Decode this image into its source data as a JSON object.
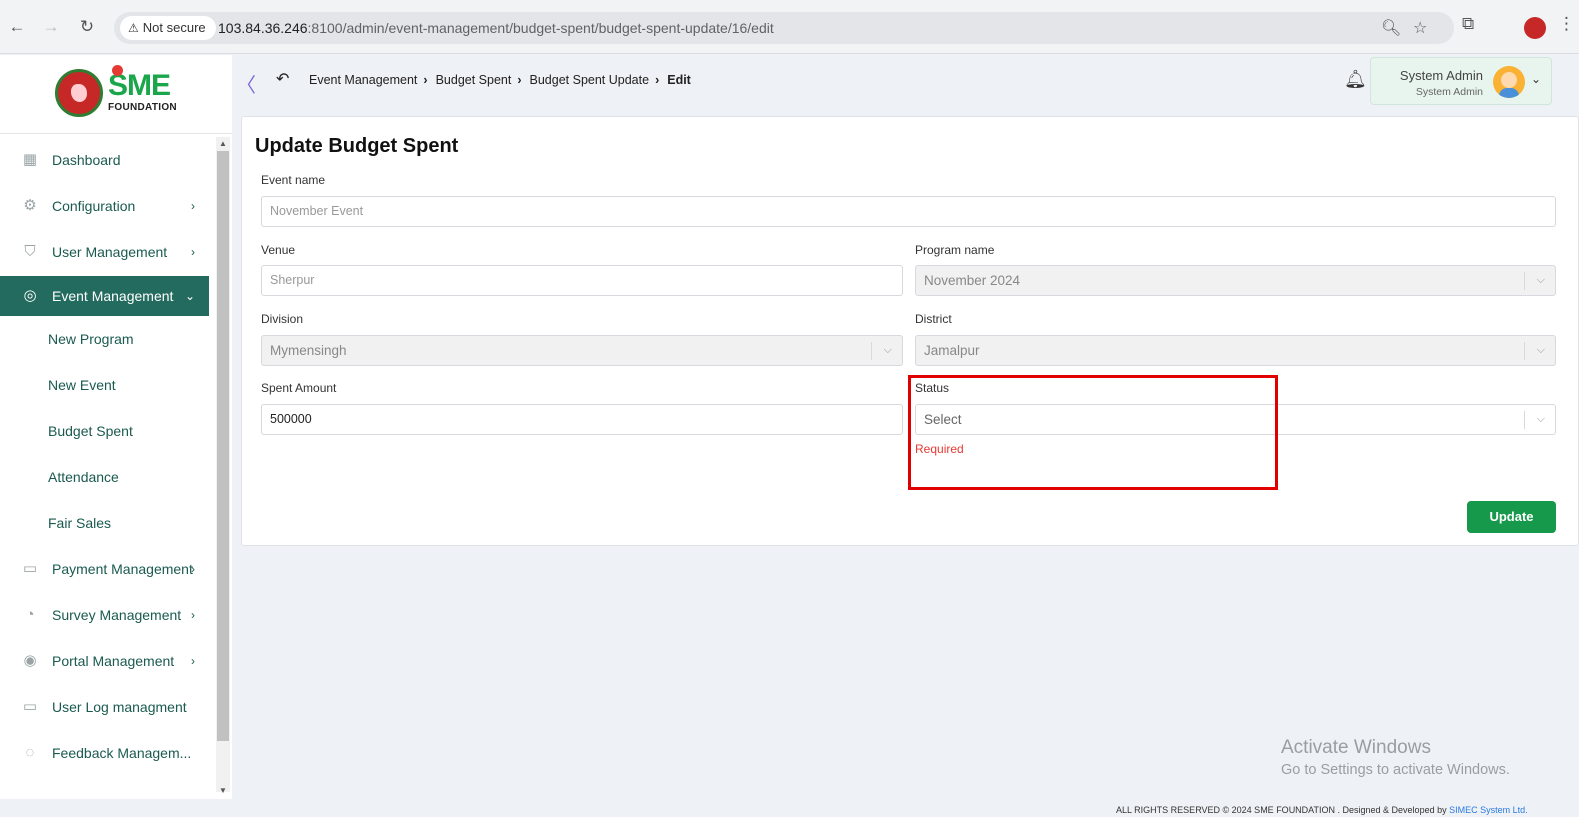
{
  "browser": {
    "security_label": "Not secure",
    "url_host": "103.84.36.246",
    "url_rest": ":8100/admin/event-management/budget-spent/budget-spent-update/16/edit"
  },
  "logo": {
    "sme": "SME",
    "foundation": "FOUNDATION"
  },
  "sidebar": {
    "items": [
      {
        "label": "Dashboard",
        "icon": "grid-icon",
        "arrow": ""
      },
      {
        "label": "Configuration",
        "icon": "config-icon",
        "arrow": "›"
      },
      {
        "label": "User Management",
        "icon": "shield-icon",
        "arrow": "›"
      },
      {
        "label": "Event Management",
        "icon": "event-icon",
        "arrow": "⌄"
      }
    ],
    "sub_items": [
      "New Program",
      "New Event",
      "Budget Spent",
      "Attendance",
      "Fair Sales"
    ],
    "items_after": [
      {
        "label": "Payment Management",
        "icon": "payment-icon",
        "arrow": "›"
      },
      {
        "label": "Survey Management",
        "icon": "pie-icon",
        "arrow": "›"
      },
      {
        "label": "Portal Management",
        "icon": "portal-icon",
        "arrow": "›"
      },
      {
        "label": "User Log managment",
        "icon": "log-icon",
        "arrow": ""
      },
      {
        "label": "Feedback Managem...",
        "icon": "feedback-icon",
        "arrow": ""
      }
    ]
  },
  "header": {
    "breadcrumb": [
      "Event Management",
      "Budget Spent",
      "Budget Spent Update",
      "Edit"
    ],
    "user_name": "System Admin",
    "user_role": "System Admin"
  },
  "form": {
    "title": "Update Budget Spent",
    "event_name_label": "Event name",
    "event_name_value": "November Event",
    "venue_label": "Venue",
    "venue_value": "Sherpur",
    "program_label": "Program name",
    "program_value": "November 2024",
    "division_label": "Division",
    "division_value": "Mymensingh",
    "district_label": "District",
    "district_value": "Jamalpur",
    "spent_label": "Spent Amount",
    "spent_value": "500000",
    "status_label": "Status",
    "status_placeholder": "Select",
    "status_error": "Required",
    "update_label": "Update"
  },
  "watermark": {
    "title": "Activate Windows",
    "subtitle": "Go to Settings to activate Windows."
  },
  "footer": {
    "text": "ALL RIGHTS RESERVED © 2024 SME FOUNDATION . Designed & Developed by ",
    "link": "SIMEC System Ltd."
  },
  "colors": {
    "accent": "#236b5e",
    "button": "#16994a",
    "error": "#e53935",
    "highlight": "#e00000"
  }
}
